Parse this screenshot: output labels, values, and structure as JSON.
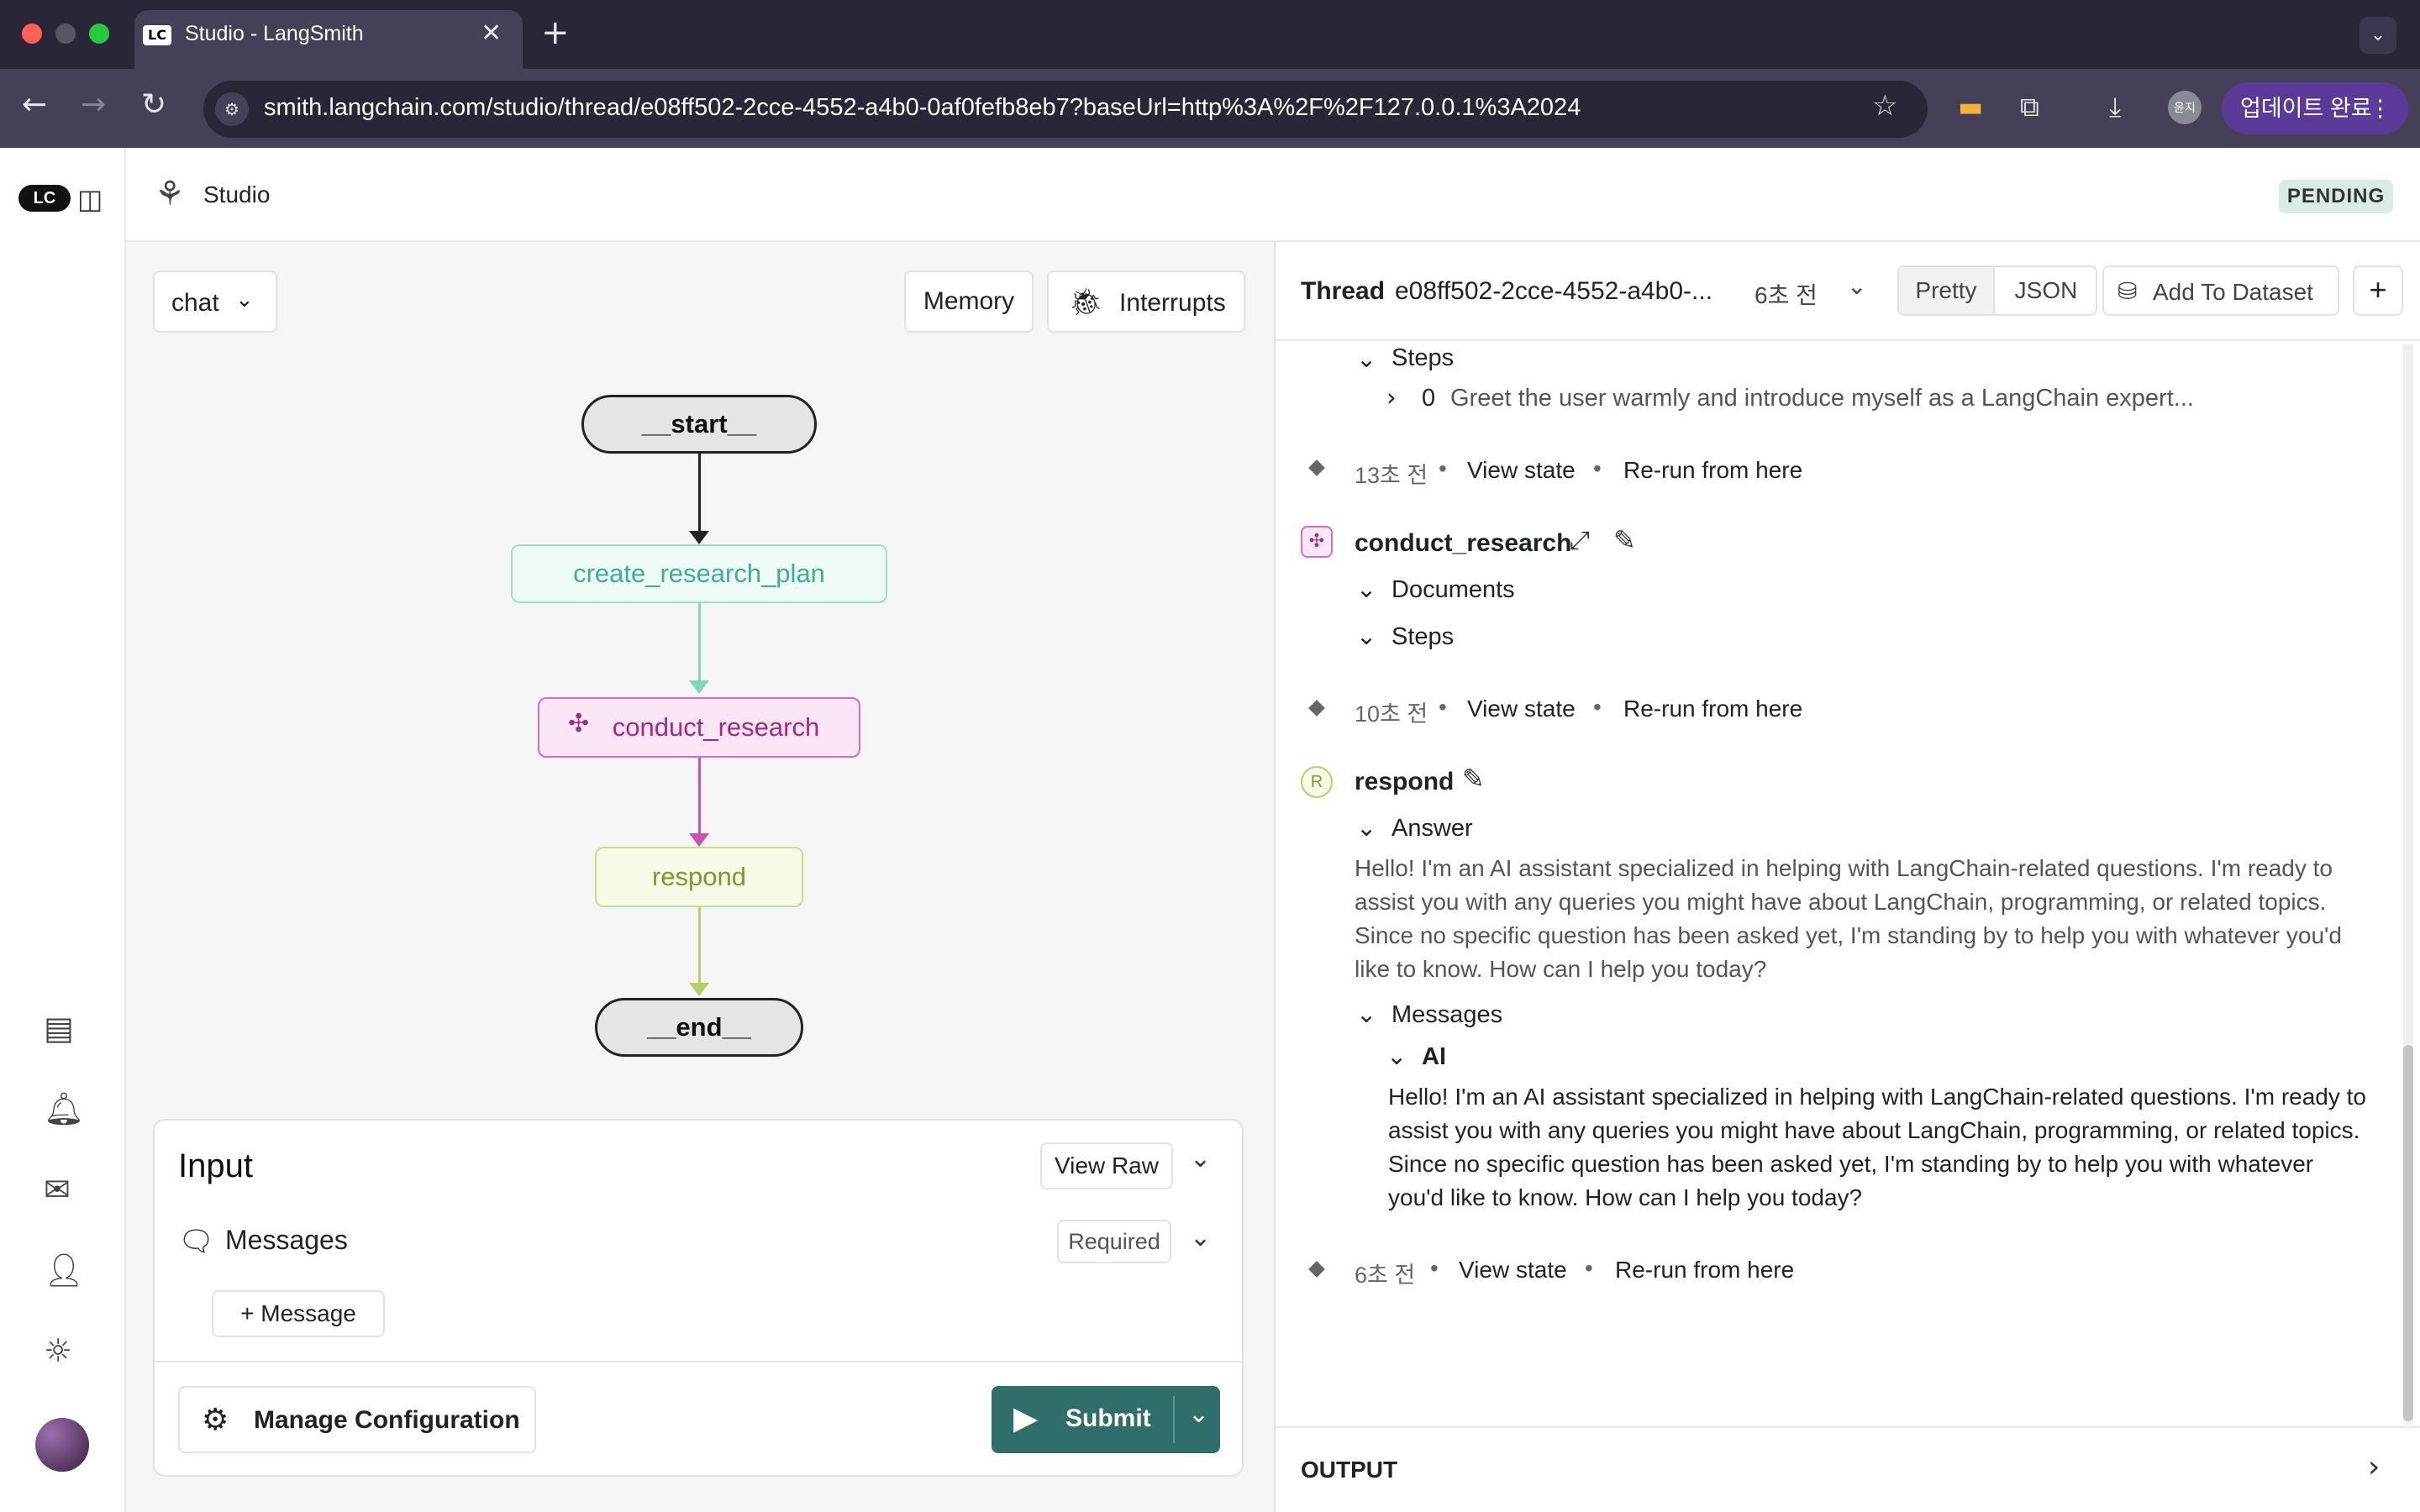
{
  "browser": {
    "tab_title": "Studio - LangSmith",
    "tab_favicon": "LC",
    "url": "smith.langchain.com/studio/thread/e08ff502-2cce-4552-a4b0-0af0fefb8eb7?baseUrl=http%3A%2F%2F127.0.0.1%3A2024",
    "update_label": "업데이트 완료",
    "profile_label": "윤지"
  },
  "app": {
    "title": "Studio",
    "status": "PENDING",
    "logo": "LC"
  },
  "graph": {
    "selector": "chat",
    "memory_label": "Memory",
    "interrupts_label": "Interrupts",
    "nodes": {
      "start": "__start__",
      "create_research_plan": "create_research_plan",
      "conduct_research": "conduct_research",
      "respond": "respond",
      "end": "__end__"
    }
  },
  "input": {
    "title": "Input",
    "view_raw": "View Raw",
    "messages_label": "Messages",
    "required_label": "Required",
    "add_message": "+ Message",
    "manage_config": "Manage Configuration",
    "submit": "Submit"
  },
  "thread": {
    "label": "Thread",
    "id": "e08ff502-2cce-4552-a4b0-...",
    "time": "6초 전",
    "pretty": "Pretty",
    "json": "JSON",
    "add_dataset": "Add To Dataset",
    "steps_label": "Steps",
    "step0_index": "0",
    "step0_text": "Greet the user warmly and introduce myself as a LangChain expert...",
    "checkpoint1": {
      "time": "13초 전",
      "view": "View state",
      "rerun": "Re-run from here"
    },
    "conduct": {
      "name": "conduct_research",
      "documents": "Documents",
      "steps": "Steps"
    },
    "checkpoint2": {
      "time": "10초 전",
      "view": "View state",
      "rerun": "Re-run from here"
    },
    "respond": {
      "badge": "R",
      "name": "respond",
      "answer_label": "Answer",
      "answer_text": "Hello! I'm an AI assistant specialized in helping with LangChain-related questions. I'm ready to assist you with any queries you might have about LangChain, programming, or related topics. Since no specific question has been asked yet, I'm standing by to help you with whatever you'd like to know. How can I help you today?",
      "messages_label": "Messages",
      "ai_label": "AI",
      "ai_text": "Hello! I'm an AI assistant specialized in helping with LangChain-related questions. I'm ready to assist you with any queries you might have about LangChain, programming, or related topics. Since no specific question has been asked yet, I'm standing by to help you with whatever you'd like to know. How can I help you today?"
    },
    "checkpoint3": {
      "time": "6초 전",
      "view": "View state",
      "rerun": "Re-run from here"
    },
    "output_label": "OUTPUT"
  },
  "colors": {
    "create_research_plan": "#5cc7a8",
    "conduct_research": "#c0399a",
    "respond": "#8ab23a",
    "submit": "#2f6e6b"
  }
}
